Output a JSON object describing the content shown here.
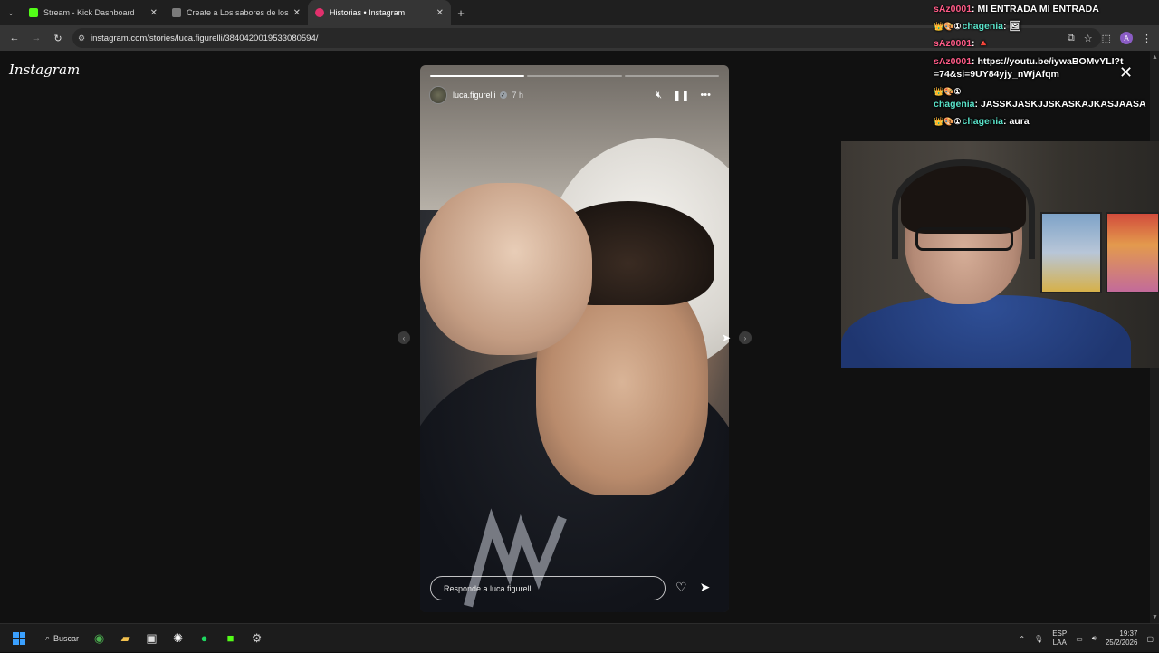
{
  "browser": {
    "tabs": [
      {
        "title": "Stream - Kick Dashboard",
        "favicon_color": "#53fc18",
        "active": false
      },
      {
        "title": "Create a Los sabores de los jug",
        "favicon_color": "#7b7b7b",
        "active": false
      },
      {
        "title": "Historias • Instagram",
        "favicon_color": "#e1306c",
        "active": true
      }
    ],
    "new_tab_symbol": "+",
    "url": "instagram.com/stories/luca.figurelli/3840420019533080594/",
    "profile_initial": "A"
  },
  "page": {
    "logo_text": "Instagram"
  },
  "story": {
    "progress": [
      1.0,
      0.0,
      0.0
    ],
    "username": "luca.figurelli",
    "time_ago": "7 h",
    "reply_placeholder": "Responde a luca.figurelli..."
  },
  "chat": {
    "messages": [
      {
        "user": "sAz0001",
        "user_color": "pink",
        "badges": "",
        "text": "MI ENTRADA MI ENTRADA"
      },
      {
        "user": "chagenia",
        "user_color": "teal",
        "badges": "👑🎨①",
        "text": ""
      },
      {
        "user": "sAz0001",
        "user_color": "pink",
        "badges": "",
        "text": "🔺"
      },
      {
        "user": "sAz0001",
        "user_color": "pink",
        "badges": "",
        "text": "https://youtu.be/iywaBOMvYLI?t=74&si=9UY84yjy_nWjAfqm"
      },
      {
        "user": "chagenia",
        "user_color": "teal",
        "badges": "👑🎨①",
        "text": "JASSKJASKJJSKASKAJKASJAASA"
      },
      {
        "user": "chagenia",
        "user_color": "teal",
        "badges": "👑🎨①",
        "text": "aura"
      }
    ]
  },
  "taskbar": {
    "search_label": "Buscar",
    "lang_top": "ESP",
    "lang_bottom": "LAA",
    "time": "19:37",
    "date": "25/2/2026"
  }
}
